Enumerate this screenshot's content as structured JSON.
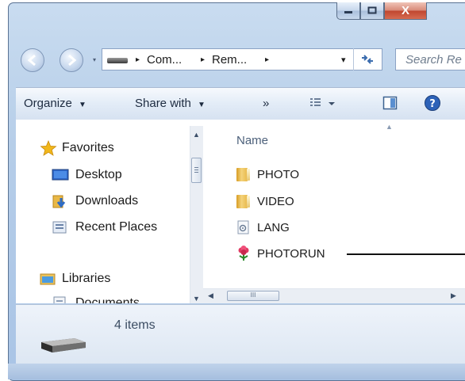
{
  "window": {
    "caption": {
      "minimize_icon": "minimize-icon",
      "maximize_icon": "maximize-icon",
      "close_label": "X"
    }
  },
  "address_bar": {
    "crumbs": [
      "Com...",
      "Rem..."
    ],
    "separator": "▸",
    "dropdown": "▾",
    "refresh_icon": "refresh-icon",
    "search_placeholder": "Search Re"
  },
  "toolbar": {
    "organize": "Organize",
    "share_with": "Share with",
    "more": "»",
    "caret": "▼",
    "views_icon": "views-icon",
    "preview_pane_icon": "preview-pane-icon",
    "help_icon": "help-icon"
  },
  "nav_pane": {
    "items": [
      {
        "label": "Favorites",
        "icon": "star-icon"
      },
      {
        "label": "Desktop",
        "icon": "desktop-icon"
      },
      {
        "label": "Downloads",
        "icon": "downloads-icon"
      },
      {
        "label": "Recent Places",
        "icon": "recent-places-icon"
      },
      {
        "label": "Libraries",
        "icon": "libraries-icon"
      },
      {
        "label": "Documents",
        "icon": "documents-icon"
      }
    ]
  },
  "file_list": {
    "column_name": "Name",
    "files": [
      {
        "name": "PHOTO",
        "icon": "folder-icon"
      },
      {
        "name": "VIDEO",
        "icon": "folder-icon"
      },
      {
        "name": "LANG",
        "icon": "settings-file-icon"
      },
      {
        "name": "PHOTORUN",
        "icon": "flower-app-icon"
      }
    ]
  },
  "details": {
    "items_count": "4 items",
    "drive_icon": "removable-drive-icon"
  },
  "colors": {
    "frame": "#b5cde8",
    "toolbar": "#e3ecf7",
    "details": "#dde7f3",
    "accent_blue": "#3a6cae"
  }
}
